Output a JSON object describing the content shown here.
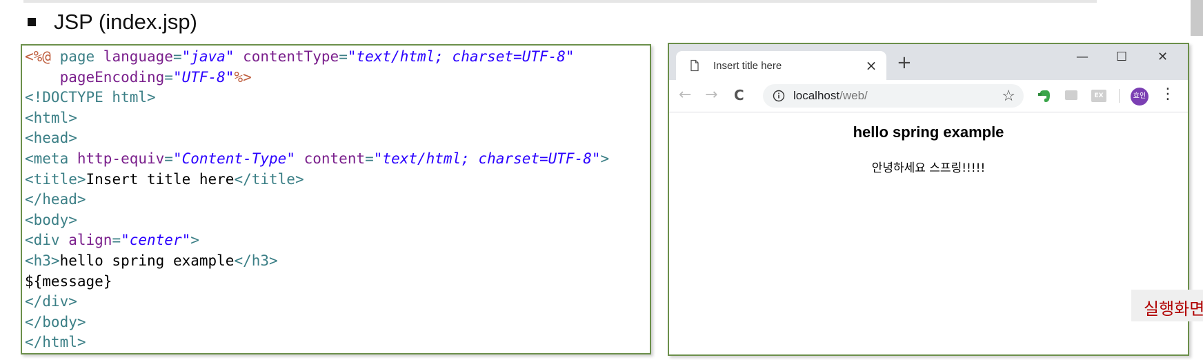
{
  "heading": "JSP (index.jsp)",
  "code_lines": [
    [
      {
        "t": "<%@ ",
        "c": "dir"
      },
      {
        "t": "page ",
        "c": "tag"
      },
      {
        "t": "language",
        "c": "attr"
      },
      {
        "t": "=",
        "c": "tag"
      },
      {
        "t": "\"java\"",
        "c": "str"
      },
      {
        "t": " contentType",
        "c": "attr"
      },
      {
        "t": "=",
        "c": "tag"
      },
      {
        "t": "\"text/html; charset=UTF-8\"",
        "c": "str"
      }
    ],
    [
      {
        "t": "    pageEncoding",
        "c": "attr"
      },
      {
        "t": "=",
        "c": "tag"
      },
      {
        "t": "\"UTF-8\"",
        "c": "str"
      },
      {
        "t": "%>",
        "c": "dir"
      }
    ],
    [
      {
        "t": "<!DOCTYPE html>",
        "c": "tag"
      }
    ],
    [
      {
        "t": "<html>",
        "c": "tag"
      }
    ],
    [
      {
        "t": "<head>",
        "c": "tag"
      }
    ],
    [
      {
        "t": "<meta ",
        "c": "tag"
      },
      {
        "t": "http-equiv",
        "c": "attr"
      },
      {
        "t": "=",
        "c": "tag"
      },
      {
        "t": "\"Content-Type\"",
        "c": "str"
      },
      {
        "t": " content",
        "c": "attr"
      },
      {
        "t": "=",
        "c": "tag"
      },
      {
        "t": "\"text/html; charset=UTF-8\"",
        "c": "str"
      },
      {
        "t": ">",
        "c": "tag"
      }
    ],
    [
      {
        "t": "<title>",
        "c": "tag"
      },
      {
        "t": "Insert title here",
        "c": "text"
      },
      {
        "t": "</title>",
        "c": "tag"
      }
    ],
    [
      {
        "t": "</head>",
        "c": "tag"
      }
    ],
    [
      {
        "t": "<body>",
        "c": "tag"
      }
    ],
    [
      {
        "t": "<div ",
        "c": "tag"
      },
      {
        "t": "align",
        "c": "attr"
      },
      {
        "t": "=",
        "c": "tag"
      },
      {
        "t": "\"center\"",
        "c": "str"
      },
      {
        "t": ">",
        "c": "tag"
      }
    ],
    [
      {
        "t": "<h3>",
        "c": "tag"
      },
      {
        "t": "hello spring example",
        "c": "text"
      },
      {
        "t": "</h3>",
        "c": "tag"
      }
    ],
    [
      {
        "t": "${message}",
        "c": "text"
      }
    ],
    [
      {
        "t": "</div>",
        "c": "tag"
      }
    ],
    [
      {
        "t": "</body>",
        "c": "tag"
      }
    ],
    [
      {
        "t": "</html>",
        "c": "tag"
      }
    ]
  ],
  "browser": {
    "tab_title": "Insert title here",
    "tab_close": "×",
    "new_tab": "+",
    "win_minimize": "—",
    "win_maximize": "☐",
    "win_close": "✕",
    "nav_back": "←",
    "nav_forward": "→",
    "nav_reload": "C",
    "url_host": "localhost",
    "url_path": "/web/",
    "star": "☆",
    "ext_label": "EX",
    "avatar_label": "효인",
    "menu": "⋮",
    "page_heading": "hello spring example",
    "page_message": "안녕하세요 스프링!!!!!"
  },
  "side_label": "실행화면"
}
